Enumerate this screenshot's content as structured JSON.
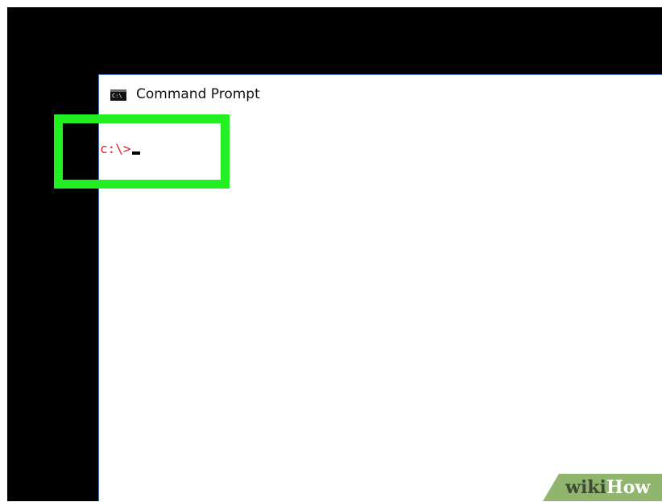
{
  "window": {
    "title": "Command Prompt",
    "icon": "command-prompt-icon",
    "icon_glyph": "C:\\"
  },
  "console": {
    "prompt": "c:\\>"
  },
  "watermark": {
    "part1": "wiki",
    "part2": "How"
  },
  "colors": {
    "backdrop": "#000000",
    "window_bg": "#ffffff",
    "prompt_text": "#e0202a",
    "highlight": "#22f022",
    "watermark_bg": "#8fb56f"
  }
}
